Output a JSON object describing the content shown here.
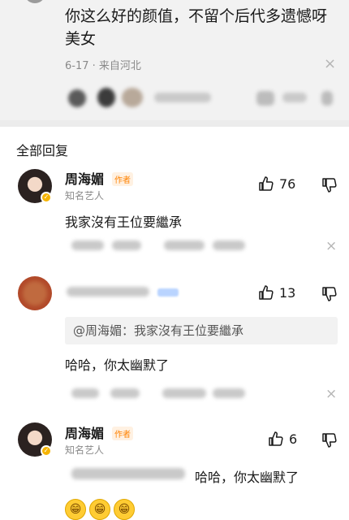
{
  "top_comment": {
    "text": "你这么好的颜值，不留个后代多遗憾呀美女",
    "meta": "6-17 · 来自河北",
    "close_glyph": "×"
  },
  "section_title": "全部回复",
  "replies": [
    {
      "name": "周海媚",
      "author_tag": "作者",
      "subtitle": "知名艺人",
      "like_count": "76",
      "body": "我家沒有王位要繼承",
      "close_glyph": "×"
    },
    {
      "name": "",
      "like_count": "13",
      "quote": "@周海媚：我家沒有王位要繼承",
      "body": "哈哈，你太幽默了",
      "close_glyph": "×"
    },
    {
      "name": "周海媚",
      "author_tag": "作者",
      "subtitle": "知名艺人",
      "like_count": "6",
      "body": "哈哈，你太幽默了"
    }
  ],
  "emoji_glyph": "😁",
  "colors": {
    "page_bg": "#ffffff",
    "top_comment_bg": "#f2f2f2",
    "author_tag": "#ff8200",
    "verified_badge": "#f6b400",
    "muted_text": "#8a8a8a"
  }
}
